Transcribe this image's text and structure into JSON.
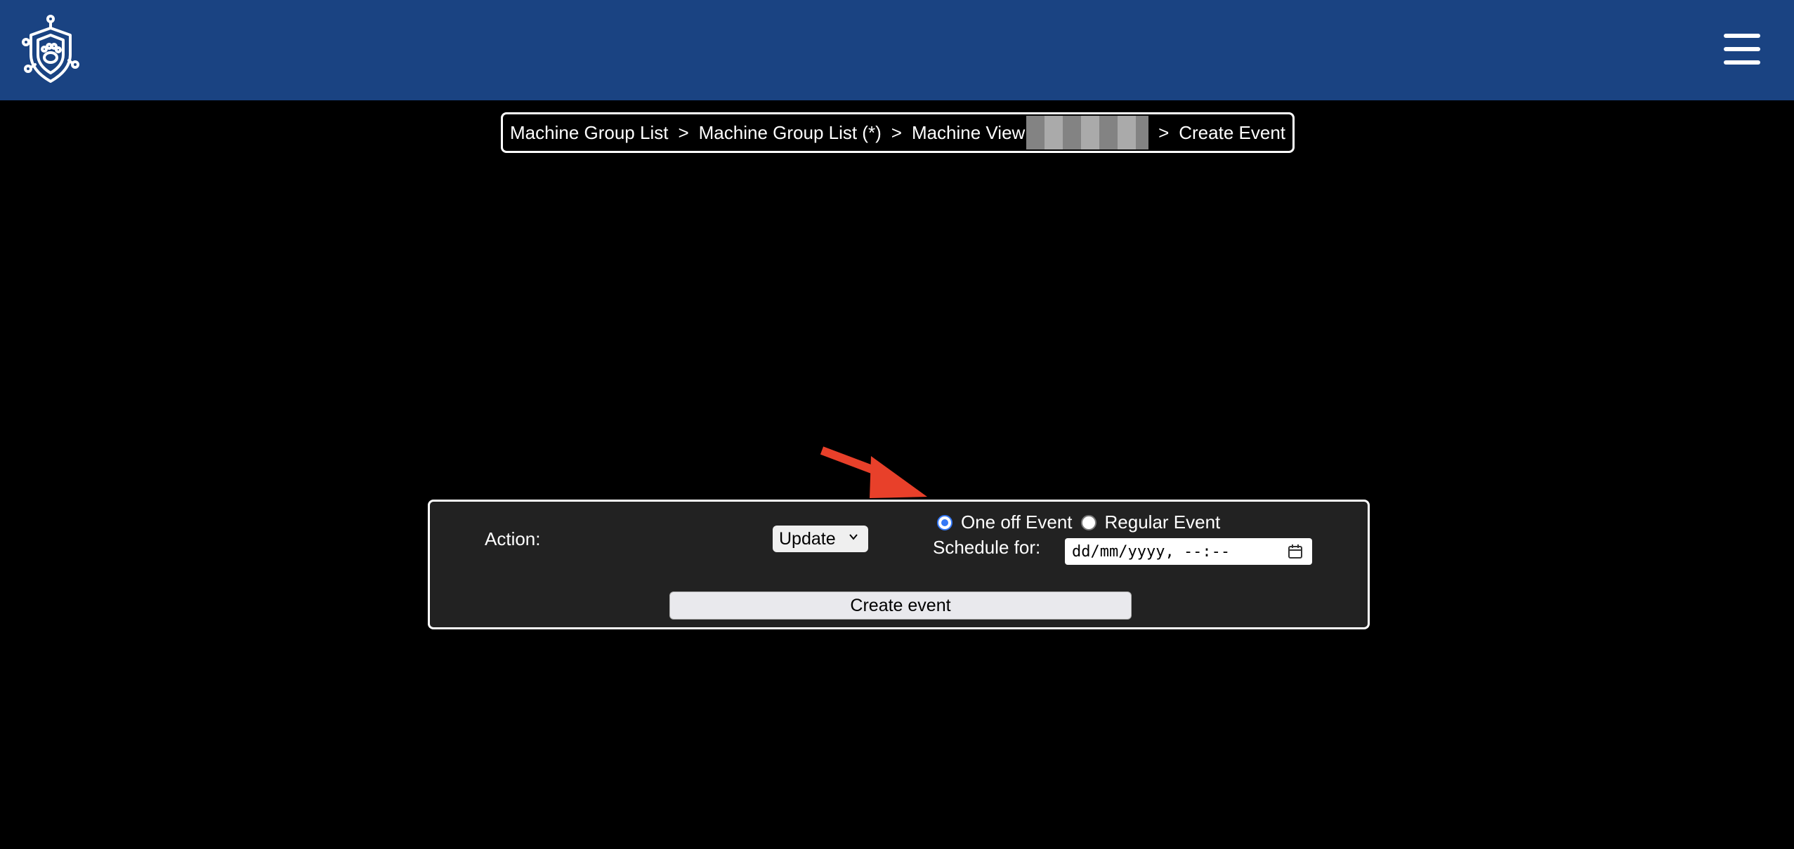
{
  "header": {
    "logo_icon": "shield-paw-icon",
    "menu_icon": "hamburger-menu-icon",
    "background": "#1a4382"
  },
  "breadcrumb": {
    "items": [
      "Machine Group List",
      "Machine Group List (*)",
      "Machine View",
      "Create Event"
    ],
    "separator": ">"
  },
  "form": {
    "action_label": "Action:",
    "action_selected": "Update",
    "event_types": [
      {
        "label": "One off Event",
        "checked": true
      },
      {
        "label": "Regular Event",
        "checked": false
      }
    ],
    "schedule_label": "Schedule for:",
    "schedule_placeholder": "dd/mm/yyyy, --:--",
    "submit_label": "Create event"
  },
  "colors": {
    "radio_accent": "#3478f6",
    "annotation_arrow": "#e8402a"
  }
}
